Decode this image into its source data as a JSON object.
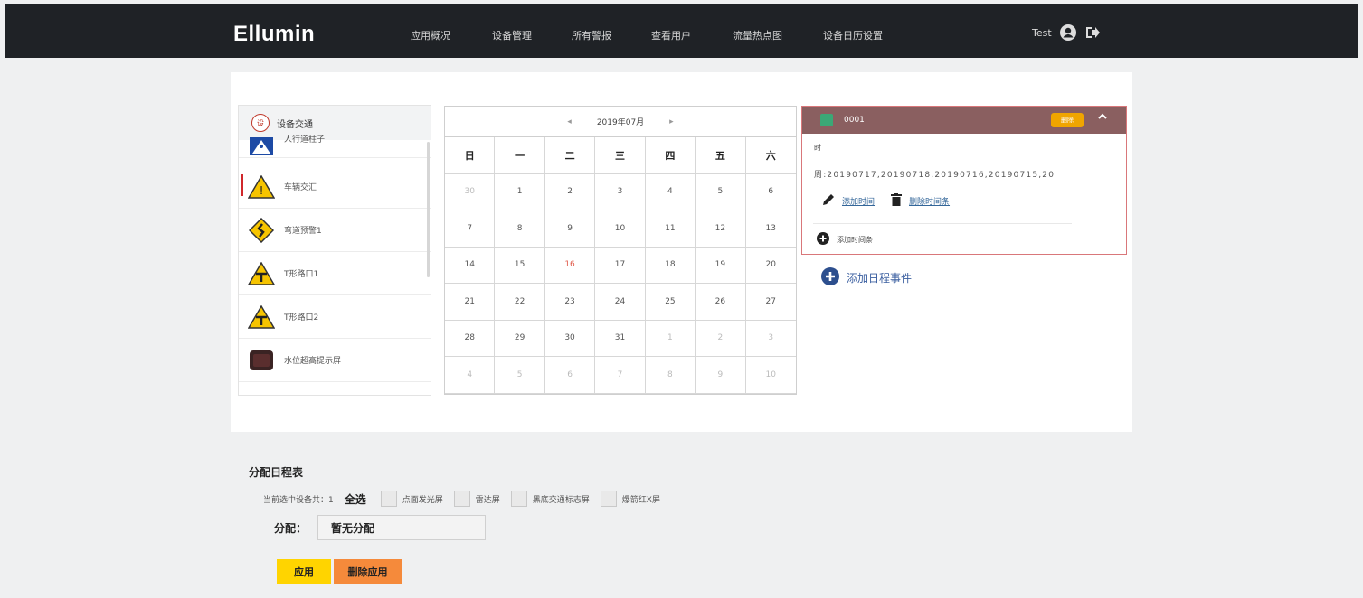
{
  "app": {
    "brand": "Ellumin"
  },
  "nav": {
    "items": [
      {
        "label": "应用概况"
      },
      {
        "label": "设备管理"
      },
      {
        "label": "所有警报"
      },
      {
        "label": "查看用户"
      },
      {
        "label": "流量热点图"
      },
      {
        "label": "设备日历设置"
      }
    ]
  },
  "user": {
    "name": "Test",
    "icons": [
      "user-circle-icon",
      "logout-icon"
    ]
  },
  "device_list": {
    "header": {
      "badge": "设",
      "label": "设备交通"
    },
    "items": [
      {
        "label": "人行道柱子",
        "icon": "pedestrian-sign-icon"
      },
      {
        "label": "车辆交汇",
        "icon": "warning-triangle-icon",
        "active": true
      },
      {
        "label": "弯道预警1",
        "icon": "curve-warning-icon"
      },
      {
        "label": "T形路口1",
        "icon": "t-junction-icon"
      },
      {
        "label": "T形路口2",
        "icon": "t-junction-icon"
      },
      {
        "label": "水位超高提示屏",
        "icon": "dark-screen-icon"
      }
    ]
  },
  "calendar": {
    "prev": "◂",
    "next": "▸",
    "month_label": "2019年07月",
    "weekdays": [
      "日",
      "一",
      "二",
      "三",
      "四",
      "五",
      "六"
    ],
    "days": [
      {
        "d": "30",
        "dim": true
      },
      {
        "d": "1"
      },
      {
        "d": "2"
      },
      {
        "d": "3"
      },
      {
        "d": "4"
      },
      {
        "d": "5"
      },
      {
        "d": "6"
      },
      {
        "d": "7"
      },
      {
        "d": "8"
      },
      {
        "d": "9"
      },
      {
        "d": "10"
      },
      {
        "d": "11"
      },
      {
        "d": "12"
      },
      {
        "d": "13"
      },
      {
        "d": "14"
      },
      {
        "d": "15"
      },
      {
        "d": "16",
        "today": true
      },
      {
        "d": "17"
      },
      {
        "d": "18"
      },
      {
        "d": "19"
      },
      {
        "d": "20"
      },
      {
        "d": "21"
      },
      {
        "d": "22"
      },
      {
        "d": "23"
      },
      {
        "d": "24"
      },
      {
        "d": "25"
      },
      {
        "d": "26"
      },
      {
        "d": "27"
      },
      {
        "d": "28"
      },
      {
        "d": "29"
      },
      {
        "d": "30"
      },
      {
        "d": "31"
      },
      {
        "d": "1",
        "dim": true
      },
      {
        "d": "2",
        "dim": true
      },
      {
        "d": "3",
        "dim": true
      },
      {
        "d": "4",
        "dim": true
      },
      {
        "d": "5",
        "dim": true
      },
      {
        "d": "6",
        "dim": true
      },
      {
        "d": "7",
        "dim": true
      },
      {
        "d": "8",
        "dim": true
      },
      {
        "d": "9",
        "dim": true
      },
      {
        "d": "10",
        "dim": true
      }
    ]
  },
  "schedule": {
    "title": "0001",
    "color": "#3aa876",
    "delete_label": "删除",
    "time_label": "时",
    "dates": "周:20190717,20190718,20190716,20190715,20",
    "add_time": "添加时间",
    "delete_time": "删除时间条",
    "add_time_bar": "添加时间条"
  },
  "add_event": "添加日程事件",
  "assign": {
    "title": "分配日程表",
    "selected_count": "当前选中设备共：1",
    "select_all": "全选",
    "options": [
      "点面发光屏",
      "雷达屏",
      "黑底交通标志屏",
      "爆箭红X屏"
    ],
    "alloc_label": "分配：",
    "alloc_value": "暂无分配",
    "apply": "应用",
    "remove": "删除应用"
  },
  "colors": {
    "topbar": "#1f2226",
    "accent_red": "#d0272b",
    "apply": "#ffd400",
    "remove": "#f58a3b",
    "schedule_head": "#8a5f60"
  }
}
